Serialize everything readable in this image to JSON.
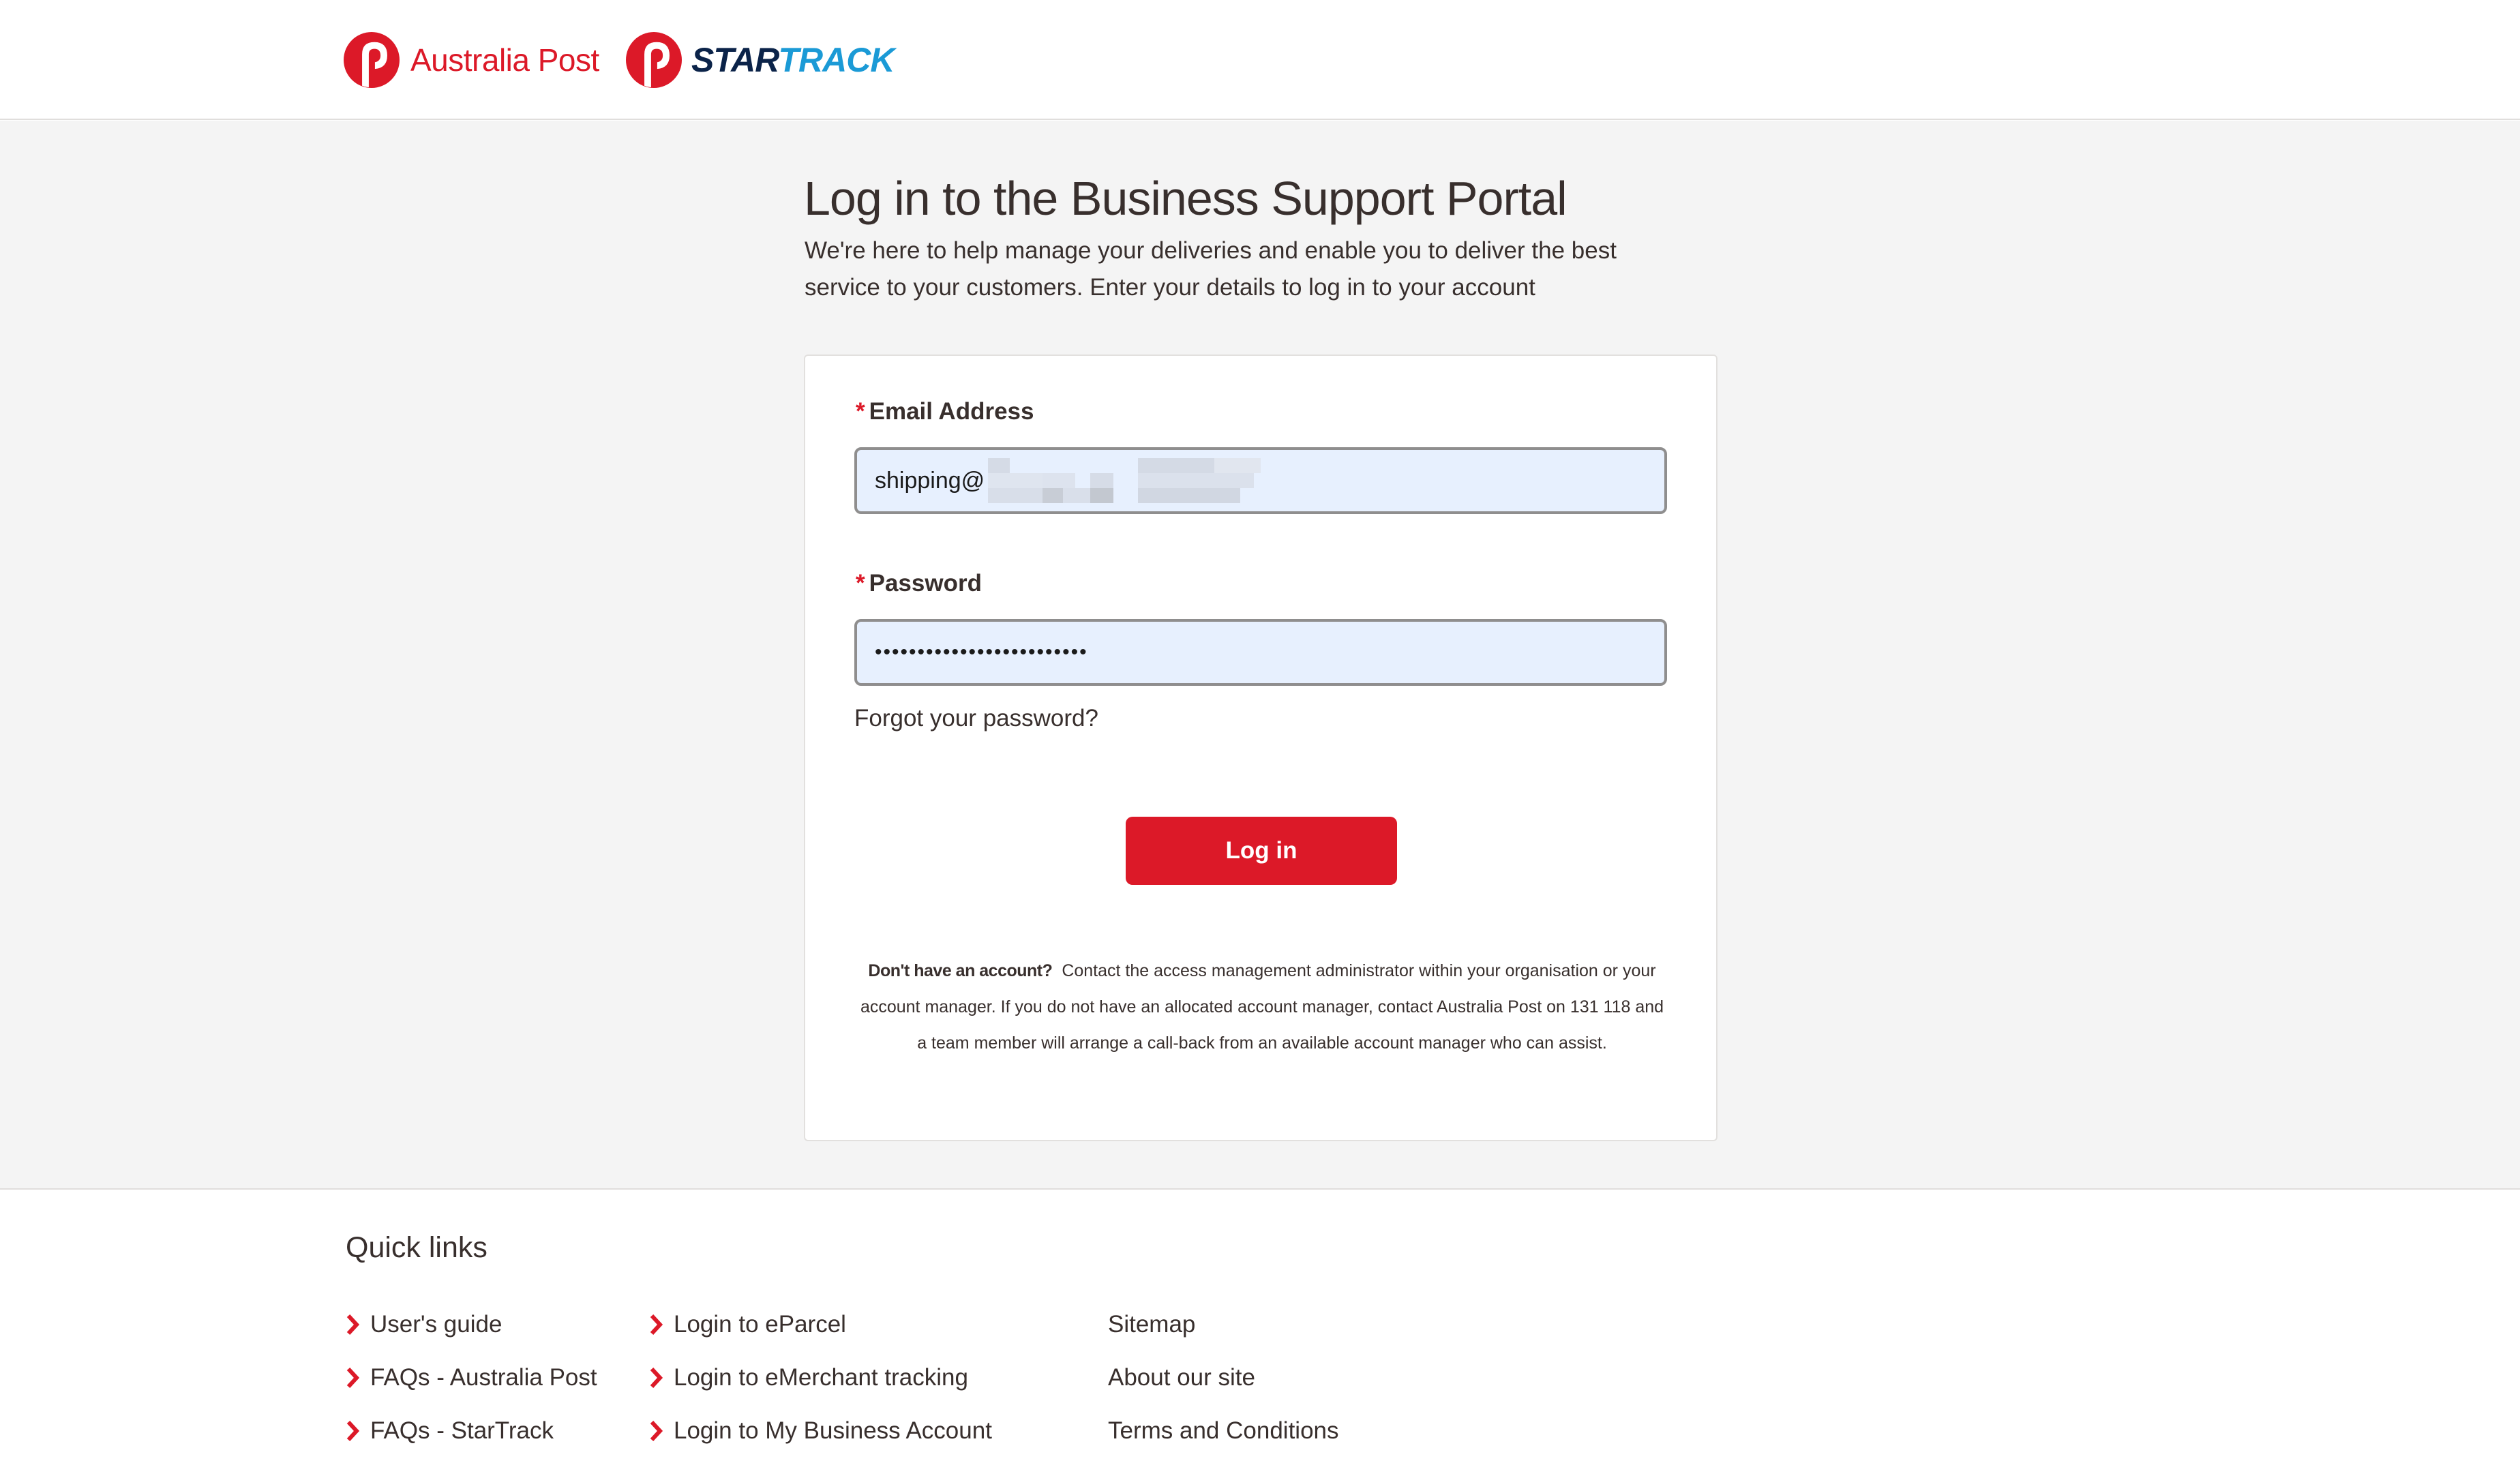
{
  "header": {
    "australia_post_brand": "Australia Post",
    "startrack_brand_star": "STAR",
    "startrack_brand_track": "TRACK"
  },
  "login": {
    "title": "Log in to the Business Support Portal",
    "intro": "We're here to help manage your deliveries and enable you to deliver the best service to your customers. Enter your details to log in to your account",
    "email_label": "Email Address",
    "email_value": "shipping@",
    "password_label": "Password",
    "password_value": "•••••••••••••••••••••••••",
    "required_marker": "*",
    "forgot_password": "Forgot your password?",
    "login_button": "Log in",
    "no_account_bold": "Don't have an account?",
    "no_account_text": "Contact the access management administrator within your organisation or your account manager. If you do not have an allocated account manager, contact Australia Post on 131 118 and a team member will arrange a call-back from an available account manager who can assist."
  },
  "quick_links": {
    "title": "Quick links",
    "column1": [
      "User's guide",
      "FAQs - Australia Post",
      "FAQs - StarTrack"
    ],
    "column2": [
      "Login to eParcel",
      "Login to eMerchant tracking",
      "Login to My Business Account"
    ],
    "column3": [
      "Sitemap",
      "About our site",
      "Terms and Conditions"
    ]
  },
  "colors": {
    "brand_red": "#dc1928",
    "startrack_navy": "#0b2349",
    "startrack_blue": "#1b9ad6",
    "page_background": "#f4f4f4",
    "input_background": "#e7f0fe"
  },
  "icons": {
    "australia_post_logo": "australia-post-p-logo-icon",
    "startrack_logo": "startrack-p-logo-icon",
    "quick_link_bullet": "chevron-right-icon"
  }
}
